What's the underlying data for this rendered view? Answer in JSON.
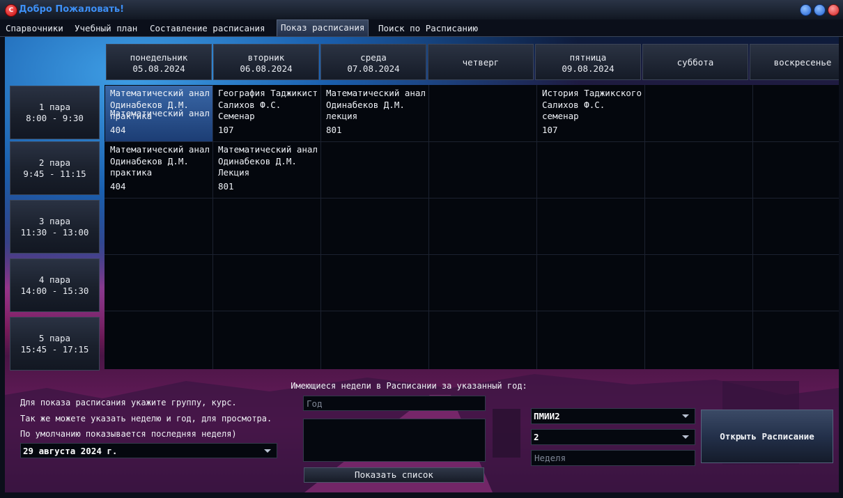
{
  "window": {
    "title": "Добро Пожаловать!",
    "icon_glyph": "C"
  },
  "tabs": [
    {
      "label": "Спарвочники"
    },
    {
      "label": "Учебный план"
    },
    {
      "label": "Составление расписания"
    },
    {
      "label": "Показ расписания"
    },
    {
      "label": "Поиск по Расписанию"
    }
  ],
  "days": [
    {
      "name": "понедельник",
      "date": "05.08.2024"
    },
    {
      "name": "вторник",
      "date": "06.08.2024"
    },
    {
      "name": "среда",
      "date": "07.08.2024"
    },
    {
      "name": "четверг",
      "date": ""
    },
    {
      "name": "пятница",
      "date": "09.08.2024"
    },
    {
      "name": "суббота",
      "date": ""
    },
    {
      "name": "воскресенье",
      "date": ""
    }
  ],
  "slots": [
    {
      "name": "1 пара",
      "time": "8:00 - 9:30"
    },
    {
      "name": "2 пара",
      "time": "9:45 - 11:15"
    },
    {
      "name": "3 пара",
      "time": "11:30 - 13:00"
    },
    {
      "name": "4 пара",
      "time": "14:00 - 15:30"
    },
    {
      "name": "5 пара",
      "time": "15:45 - 17:15"
    }
  ],
  "lessons": {
    "r1_mon": {
      "subject": "Математический анал",
      "teacher": "Одинабеков Д.М.",
      "type": "практика",
      "room": "404",
      "overlap": "Математический анал"
    },
    "r1_tue": {
      "subject": "География Таджикист",
      "teacher": "Салихов Ф.С.",
      "type": "Семенар",
      "room": "107"
    },
    "r1_wed": {
      "subject": "Математический анал",
      "teacher": "Одинабеков Д.М.",
      "type": "лекция",
      "room": "801"
    },
    "r1_fri": {
      "subject": "История Таджикского",
      "teacher": "Салихов Ф.С.",
      "type": "семенар",
      "room": "107"
    },
    "r2_mon": {
      "subject": "Математический анал",
      "teacher": "Одинабеков Д.М.",
      "type": "практика",
      "room": "404"
    },
    "r2_tue": {
      "subject": "Математический анал",
      "teacher": "Одинабеков Д.М.",
      "type": "Лекция",
      "room": "801"
    }
  },
  "bottom": {
    "weeks_label": "Имеющиеся недели в Расписании за указанный год:",
    "info": [
      "Для показа расписания укажите группу, курс.",
      "Так же можете указать неделю и год, для просмотра.",
      "По умолчанию показывается последняя неделя)"
    ],
    "date_value": "29 августа 2024 г.",
    "year_placeholder": "Год",
    "show_list_label": "Показать список",
    "group_value": "ПМИИ2",
    "course_value": "2",
    "week_placeholder": "Неделя",
    "open_label": "Открыть Расписание"
  }
}
